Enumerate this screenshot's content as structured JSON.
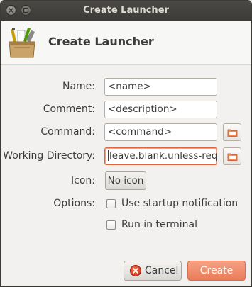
{
  "window": {
    "title": "Create Launcher"
  },
  "header": {
    "title": "Create Launcher",
    "icon": "launcher-box-icon"
  },
  "form": {
    "name": {
      "label": "Name:",
      "value": "<name>"
    },
    "comment": {
      "label": "Comment:",
      "value": "<description>"
    },
    "command": {
      "label": "Command:",
      "value": "<command>"
    },
    "working_directory": {
      "label": "Working Directory:",
      "value": "leave.blank.unless-reqd"
    },
    "icon": {
      "label": "Icon:",
      "button": "No icon"
    },
    "options": {
      "label": "Options:",
      "startup_notification": {
        "label": "Use startup notification",
        "checked": false
      },
      "run_in_terminal": {
        "label": "Run in terminal",
        "checked": false
      }
    }
  },
  "buttons": {
    "cancel": "Cancel",
    "create": "Create"
  },
  "colors": {
    "accent": "#e0643b",
    "titlebar": "#3c3b37",
    "create_button": "#ee8a67"
  }
}
